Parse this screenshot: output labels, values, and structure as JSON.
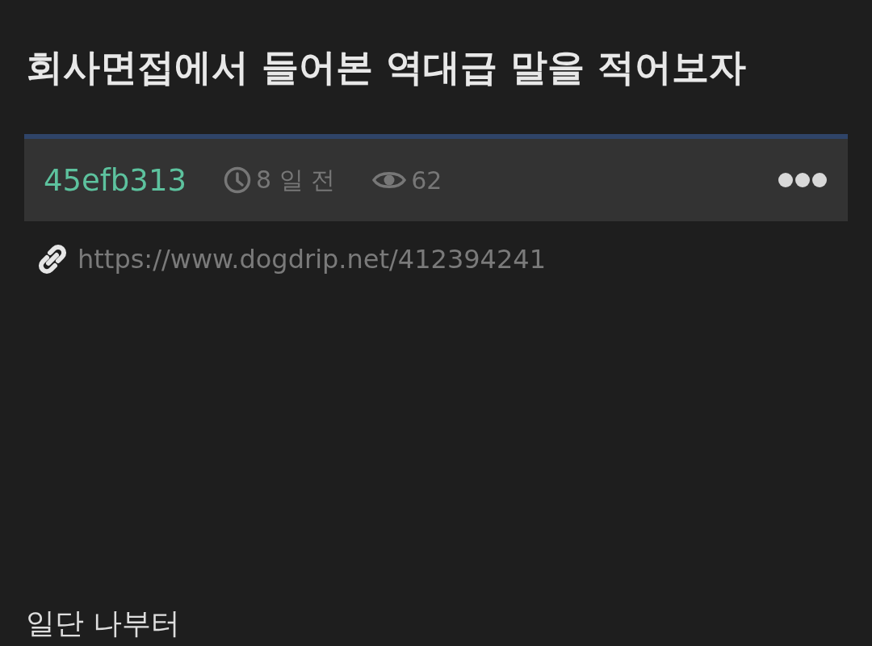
{
  "post": {
    "title": "회사면접에서 들어본 역대급 말을 적어보자",
    "author": "45efb313",
    "time": "8 일 전",
    "views": "62",
    "link": "https://www.dogdrip.net/412394241",
    "body": "일단 나부터"
  }
}
